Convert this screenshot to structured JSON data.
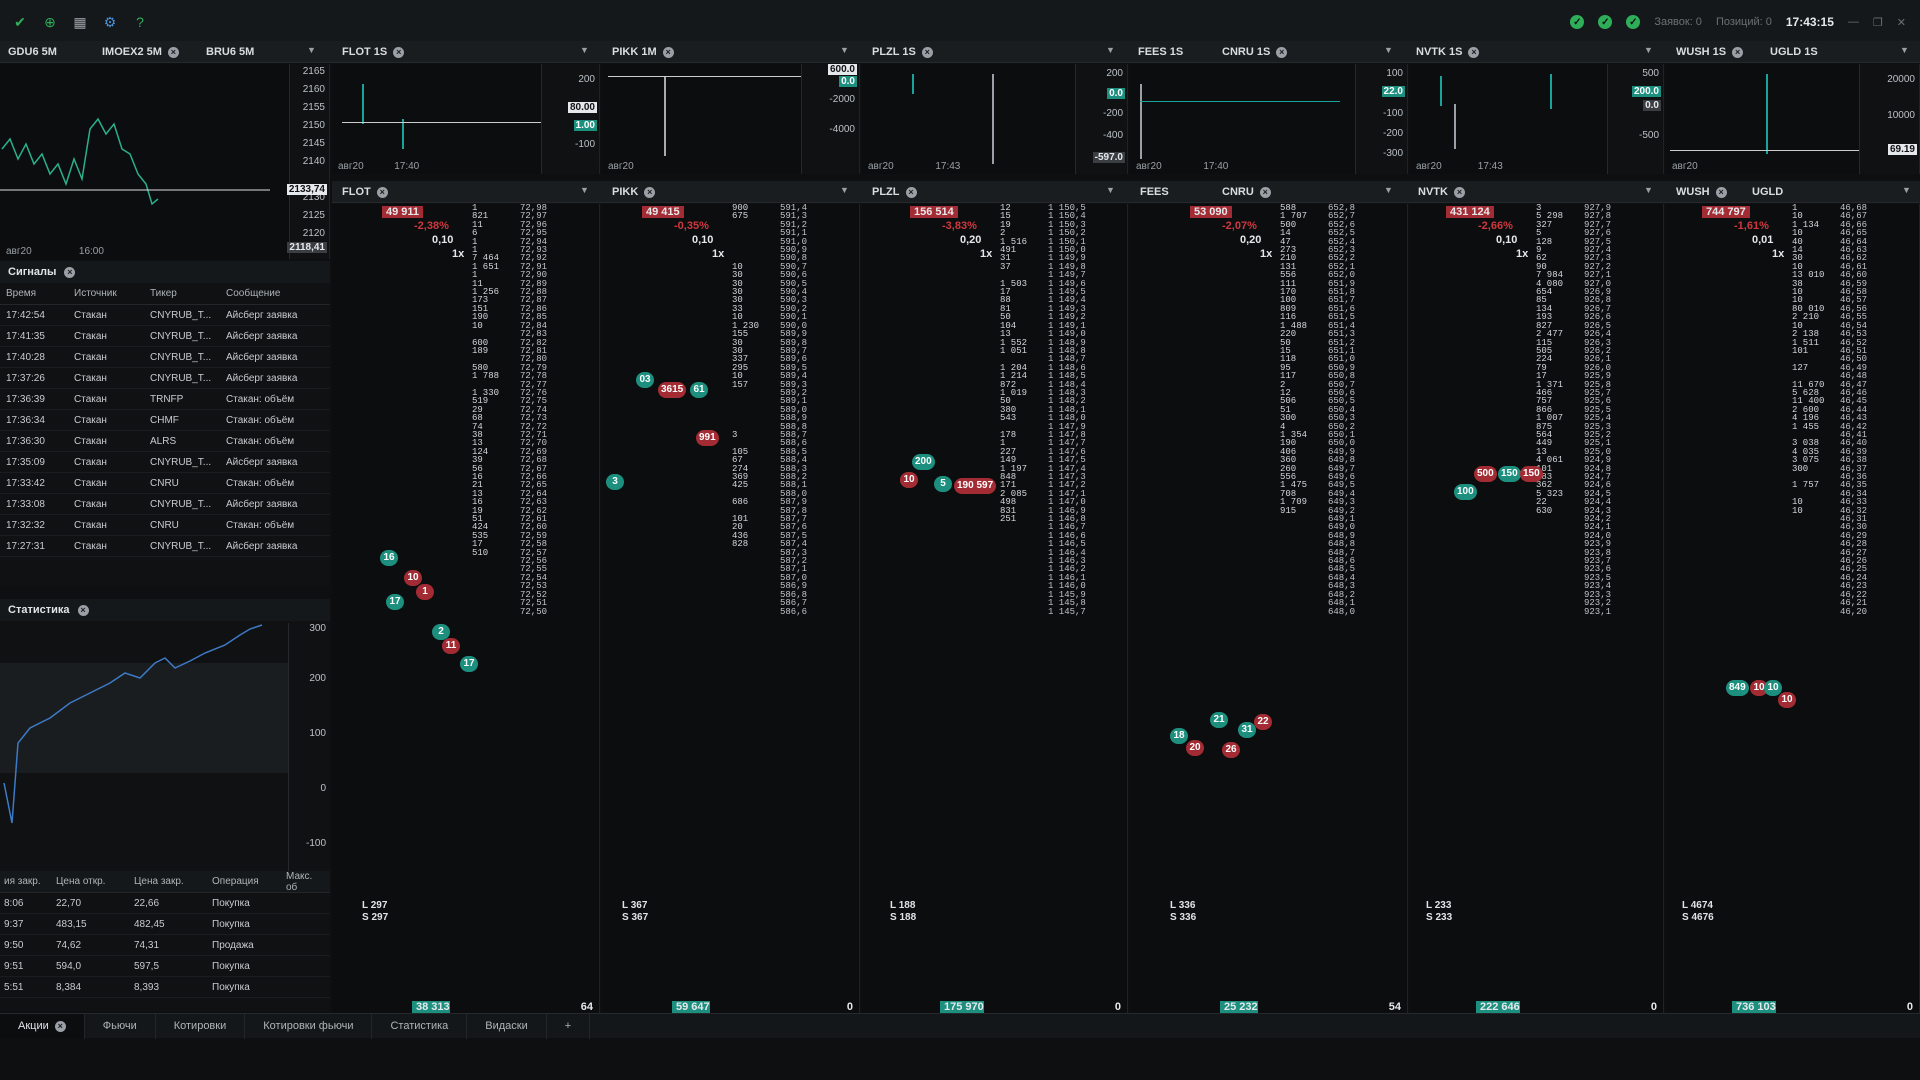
{
  "topbar": {
    "clock": "17:43:15",
    "orders": "Заявок: 0",
    "positions": "Позиций: 0"
  },
  "charts": [
    {
      "tab": "GDU6 5M",
      "t2": "IMOEX2 5M",
      "t3": "BRU6 5M",
      "axis": [
        "2165",
        "2160",
        "2155",
        "2150",
        "2145",
        "2140",
        "2135",
        "2130",
        "2125",
        "2120"
      ],
      "mark": "2133,74",
      "mark2": "2118,41",
      "dates": [
        "авг20",
        "16:00"
      ]
    },
    {
      "tab": "FLOT 1S",
      "axis": [
        "200",
        "-100"
      ],
      "mark": "80.00",
      "mark2": "1.00",
      "dates": [
        "авг20",
        "17:40"
      ]
    },
    {
      "tab": "PIKK 1M",
      "axis": [
        "600.0",
        "-2000",
        "-4000"
      ],
      "mark": "0.0",
      "dates": [
        "авг20"
      ]
    },
    {
      "tab": "PLZL 1S",
      "axis": [
        "200",
        "-200",
        "-400"
      ],
      "mark": "0.0",
      "mark2": "-597.0",
      "dates": [
        "авг20",
        "17:43"
      ]
    },
    {
      "tab": "FEES 1S",
      "t2": "CNRU 1S",
      "axis": [
        "100",
        "-100",
        "-200",
        "-300"
      ],
      "mark": "22.0",
      "dates": [
        "авг20",
        "17:40"
      ]
    },
    {
      "tab": "NVTK 1S",
      "axis": [
        "500",
        "-500"
      ],
      "mark": "200.0",
      "mark2": "0.0",
      "dates": [
        "авг20",
        "17:43"
      ]
    },
    {
      "tab": "WUSH 1S",
      "t2": "UGLD 1S",
      "axis": [
        "20000",
        "10000"
      ],
      "mark": "69.19",
      "dates": [
        "авг20"
      ]
    }
  ],
  "signals": {
    "title": "Сигналы",
    "cols": [
      "Время",
      "Источник",
      "Тикер",
      "Сообщение"
    ],
    "rows": [
      [
        "17:42:54",
        "Стакан",
        "CNYRUB_T...",
        "Айсберг заявка"
      ],
      [
        "17:41:35",
        "Стакан",
        "CNYRUB_T...",
        "Айсберг заявка"
      ],
      [
        "17:40:28",
        "Стакан",
        "CNYRUB_T...",
        "Айсберг заявка"
      ],
      [
        "17:37:26",
        "Стакан",
        "CNYRUB_T...",
        "Айсберг заявка"
      ],
      [
        "17:36:39",
        "Стакан",
        "TRNFP",
        "Стакан: объём"
      ],
      [
        "17:36:34",
        "Стакан",
        "CHMF",
        "Стакан: объём"
      ],
      [
        "17:36:30",
        "Стакан",
        "ALRS",
        "Стакан: объём"
      ],
      [
        "17:35:09",
        "Стакан",
        "CNYRUB_T...",
        "Айсберг заявка"
      ],
      [
        "17:33:42",
        "Стакан",
        "CNRU",
        "Стакан: объём"
      ],
      [
        "17:33:08",
        "Стакан",
        "CNYRUB_T...",
        "Айсберг заявка"
      ],
      [
        "17:32:32",
        "Стакан",
        "CNRU",
        "Стакан: объём"
      ],
      [
        "17:27:31",
        "Стакан",
        "CNYRUB_T...",
        "Айсберг заявка"
      ]
    ]
  },
  "stats": {
    "title": "Статистика",
    "axis": [
      "300",
      "200",
      "100",
      "0",
      "-100"
    ]
  },
  "trades": {
    "cols": [
      "ия закр.",
      "Цена откр.",
      "Цена закр.",
      "Операция",
      "Макс. об"
    ],
    "rows": [
      [
        "8:06",
        "22,70",
        "22,66",
        "Покупка"
      ],
      [
        "9:37",
        "483,15",
        "482,45",
        "Покупка"
      ],
      [
        "9:50",
        "74,62",
        "74,31",
        "Продажа"
      ],
      [
        "9:51",
        "594,0",
        "597,5",
        "Покупка"
      ],
      [
        "5:51",
        "8,384",
        "8,393",
        "Покупка"
      ]
    ]
  },
  "books": [
    {
      "t": "FLOT",
      "v": "49 911",
      "p": "-2,38%",
      "s": "0,10",
      "m": "1x",
      "L": "L 297",
      "S": "S 297",
      "f": "38 313",
      "f2": "64",
      "pr": [
        "72,98",
        "72,97",
        "72,96",
        "72,95",
        "72,94",
        "72,93",
        "72,92",
        "72,91",
        "72,90",
        "72,89",
        "72,88",
        "72,87",
        "72,86",
        "72,85",
        "72,84",
        "72,83",
        "72,82",
        "72,81",
        "72,80",
        "72,79",
        "72,78",
        "72,77",
        "72,76",
        "72,75",
        "72,74",
        "72,73",
        "72,72",
        "72,71",
        "72,70",
        "72,69",
        "72,68",
        "72,67",
        "72,66",
        "72,65",
        "72,64",
        "72,63",
        "72,62",
        "72,61",
        "72,60",
        "72,59",
        "72,58",
        "72,57",
        "72,56",
        "72,55",
        "72,54",
        "72,53",
        "72,52",
        "72,51",
        "72,50"
      ],
      "vo": [
        "1",
        "821",
        "11",
        "6",
        "1",
        "1",
        "7 464",
        "1 651",
        "1",
        "11",
        "1 256",
        "173",
        "151",
        "190",
        "10",
        "",
        "600",
        "189",
        "",
        "580",
        "1 788",
        "",
        "1 330",
        "519",
        "29",
        "68",
        "74",
        "38",
        "13",
        "124",
        "39",
        "56",
        "16",
        "21",
        "13",
        "16",
        "19",
        "51",
        "424",
        "535",
        "17",
        "510"
      ]
    },
    {
      "t": "PIKK",
      "v": "49 415",
      "p": "-0,35%",
      "s": "0,10",
      "m": "1x",
      "L": "L 367",
      "S": "S 367",
      "f": "59 647",
      "f2": "0",
      "pr": [
        "591,4",
        "591,3",
        "591,2",
        "591,1",
        "591,0",
        "590,9",
        "590,8",
        "590,7",
        "590,6",
        "590,5",
        "590,4",
        "590,3",
        "590,2",
        "590,1",
        "590,0",
        "589,9",
        "589,8",
        "589,7",
        "589,6",
        "589,5",
        "589,4",
        "589,3",
        "589,2",
        "589,1",
        "589,0",
        "588,9",
        "588,8",
        "588,7",
        "588,6",
        "588,5",
        "588,4",
        "588,3",
        "588,2",
        "588,1",
        "588,0",
        "587,9",
        "587,8",
        "587,7",
        "587,6",
        "587,5",
        "587,4",
        "587,3",
        "587,2",
        "587,1",
        "587,0",
        "586,9",
        "586,8",
        "586,7",
        "586,6"
      ],
      "vo": [
        "900",
        "675",
        "",
        "",
        "",
        "",
        "",
        "10",
        "30",
        "30",
        "30",
        "30",
        "33",
        "10",
        "1 230",
        "155",
        "30",
        "30",
        "337",
        "295",
        "10",
        "157",
        "",
        "",
        "",
        "",
        "",
        "3",
        "",
        "105",
        "67",
        "274",
        "369",
        "425",
        "",
        "686",
        "",
        "101",
        "20",
        "436",
        "828"
      ]
    },
    {
      "t": "PLZL",
      "v": "156 514",
      "p": "-3,83%",
      "s": "0,20",
      "m": "1x",
      "L": "L 188",
      "S": "S 188",
      "f": "175 970",
      "f2": "0",
      "pr": [
        "1 150,5",
        "1 150,4",
        "1 150,3",
        "1 150,2",
        "1 150,1",
        "1 150,0",
        "1 149,9",
        "1 149,8",
        "1 149,7",
        "1 149,6",
        "1 149,5",
        "1 149,4",
        "1 149,3",
        "1 149,2",
        "1 149,1",
        "1 149,0",
        "1 148,9",
        "1 148,8",
        "1 148,7",
        "1 148,6",
        "1 148,5",
        "1 148,4",
        "1 148,3",
        "1 148,2",
        "1 148,1",
        "1 148,0",
        "1 147,9",
        "1 147,8",
        "1 147,7",
        "1 147,6",
        "1 147,5",
        "1 147,4",
        "1 147,3",
        "1 147,2",
        "1 147,1",
        "1 147,0",
        "1 146,9",
        "1 146,8",
        "1 146,7",
        "1 146,6",
        "1 146,5",
        "1 146,4",
        "1 146,3",
        "1 146,2",
        "1 146,1",
        "1 146,0",
        "1 145,9",
        "1 145,8",
        "1 145,7"
      ],
      "vo": [
        "12",
        "15",
        "19",
        "2",
        "1 516",
        "491",
        "31",
        "37",
        "",
        "1 503",
        "17",
        "88",
        "81",
        "50",
        "104",
        "13",
        "1 552",
        "1 051",
        "",
        "1 204",
        "1 214",
        "872",
        "1 019",
        "50",
        "380",
        "543",
        "",
        "178",
        "1",
        "227",
        "149",
        "1 197",
        "848",
        "171",
        "2 085",
        "498",
        "831",
        "251"
      ]
    },
    {
      "t": "FEES",
      "t2": "CNRU",
      "v": "53 090",
      "p": "-2,07%",
      "s": "0,20",
      "m": "1x",
      "L": "L 336",
      "S": "S 336",
      "f": "25 232",
      "f2": "54",
      "pr": [
        "652,8",
        "652,7",
        "652,6",
        "652,5",
        "652,4",
        "652,3",
        "652,2",
        "652,1",
        "652,0",
        "651,9",
        "651,8",
        "651,7",
        "651,6",
        "651,5",
        "651,4",
        "651,3",
        "651,2",
        "651,1",
        "651,0",
        "650,9",
        "650,8",
        "650,7",
        "650,6",
        "650,5",
        "650,4",
        "650,3",
        "650,2",
        "650,1",
        "650,0",
        "649,9",
        "649,8",
        "649,7",
        "649,6",
        "649,5",
        "649,4",
        "649,3",
        "649,2",
        "649,1",
        "649,0",
        "648,9",
        "648,8",
        "648,7",
        "648,6",
        "648,5",
        "648,4",
        "648,3",
        "648,2",
        "648,1",
        "648,0"
      ],
      "vo": [
        "588",
        "1 707",
        "500",
        "14",
        "47",
        "273",
        "210",
        "131",
        "556",
        "111",
        "170",
        "100",
        "809",
        "116",
        "1 488",
        "220",
        "50",
        "15",
        "118",
        "95",
        "117",
        "2",
        "12",
        "506",
        "51",
        "300",
        "4",
        "1 354",
        "190",
        "406",
        "360",
        "260",
        "556",
        "1 475",
        "708",
        "1 709",
        "915"
      ]
    },
    {
      "t": "NVTK",
      "v": "431 124",
      "p": "-2,66%",
      "s": "0,10",
      "m": "1x",
      "L": "L 233",
      "S": "S 233",
      "f": "222 646",
      "f2": "0",
      "pr": [
        "927,9",
        "927,8",
        "927,7",
        "927,6",
        "927,5",
        "927,4",
        "927,3",
        "927,2",
        "927,1",
        "927,0",
        "926,9",
        "926,8",
        "926,7",
        "926,6",
        "926,5",
        "926,4",
        "926,3",
        "926,2",
        "926,1",
        "926,0",
        "925,9",
        "925,8",
        "925,7",
        "925,6",
        "925,5",
        "925,4",
        "925,3",
        "925,2",
        "925,1",
        "925,0",
        "924,9",
        "924,8",
        "924,7",
        "924,6",
        "924,5",
        "924,4",
        "924,3",
        "924,2",
        "924,1",
        "924,0",
        "923,9",
        "923,8",
        "923,7",
        "923,6",
        "923,5",
        "923,4",
        "923,3",
        "923,2",
        "923,1"
      ],
      "vo": [
        "3",
        "5 298",
        "327",
        "5",
        "128",
        "9",
        "62",
        "90",
        "7 984",
        "4 080",
        "654",
        "85",
        "134",
        "193",
        "827",
        "2 477",
        "115",
        "505",
        "224",
        "79",
        "17",
        "1 371",
        "466",
        "757",
        "866",
        "1 007",
        "875",
        "564",
        "449",
        "13",
        "4 061",
        "101",
        "583",
        "362",
        "5 323",
        "22",
        "630"
      ]
    },
    {
      "t": "WUSH",
      "t2": "UGLD",
      "v": "744 797",
      "p": "-1,61%",
      "s": "0,01",
      "m": "1x",
      "L": "L 4674",
      "S": "S 4676",
      "f": "736 103",
      "f2": "0",
      "pr": [
        "46,68",
        "46,67",
        "46,66",
        "46,65",
        "46,64",
        "46,63",
        "46,62",
        "46,61",
        "46,60",
        "46,59",
        "46,58",
        "46,57",
        "46,56",
        "46,55",
        "46,54",
        "46,53",
        "46,52",
        "46,51",
        "46,50",
        "46,49",
        "46,48",
        "46,47",
        "46,46",
        "46,45",
        "46,44",
        "46,43",
        "46,42",
        "46,41",
        "46,40",
        "46,39",
        "46,38",
        "46,37",
        "46,36",
        "46,35",
        "46,34",
        "46,33",
        "46,32",
        "46,31",
        "46,30",
        "46,29",
        "46,28",
        "46,27",
        "46,26",
        "46,25",
        "46,24",
        "46,23",
        "46,22",
        "46,21",
        "46,20"
      ],
      "vo": [
        "1",
        "10",
        "1 134",
        "10",
        "40",
        "14",
        "30",
        "10",
        "13 010",
        "38",
        "10",
        "10",
        "80 010",
        "2 210",
        "10",
        "2 138",
        "1 511",
        "101",
        "",
        "127",
        "",
        "11 670",
        "5 628",
        "11 400",
        "2 600",
        "4 196",
        "1 455",
        "",
        "3 038",
        "4 035",
        "3 075",
        "300",
        "",
        "1 757",
        "",
        "10",
        "10"
      ]
    }
  ],
  "bubbles": {
    "flot": [
      "16",
      "10",
      "17",
      "1",
      "2",
      "11",
      "17"
    ],
    "pikk": [
      "03",
      "3615",
      "61",
      "991",
      "3"
    ],
    "plzl": [
      "200",
      "10",
      "5",
      "190 597"
    ],
    "cnru": [
      "18",
      "20",
      "21",
      "26",
      "31",
      "22"
    ],
    "nvtk": [
      "100",
      "500",
      "150",
      "150"
    ],
    "wush": [
      "849",
      "10",
      "10",
      "10"
    ]
  },
  "tabs": [
    "Акции",
    "Фьючи",
    "Котировки",
    "Котировки фьючи",
    "Статистика",
    "Видаски",
    "+"
  ]
}
